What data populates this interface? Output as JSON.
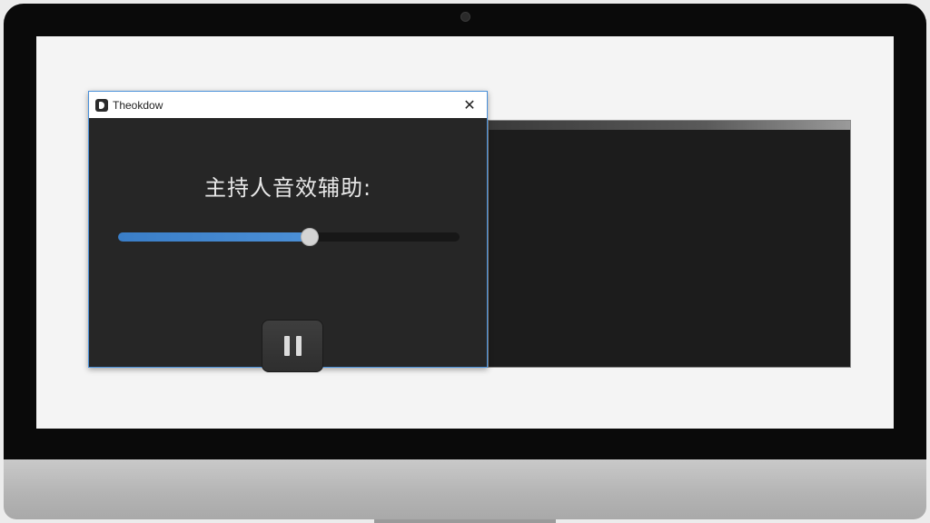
{
  "app_window": {
    "title": "Theokdow",
    "close_glyph": "✕",
    "heading": "主持人音效辅助:",
    "volume_slider": {
      "value_percent": 56
    },
    "pause_button": {
      "state": "playing",
      "icon": "pause-icon"
    }
  },
  "waveform_window": {
    "colors": {
      "start": "#3b8fd4",
      "end": "#35c27a"
    }
  },
  "colors": {
    "accent": "#4a90d9",
    "window_bg": "#262626",
    "waveform_bg": "#1c1c1c"
  }
}
